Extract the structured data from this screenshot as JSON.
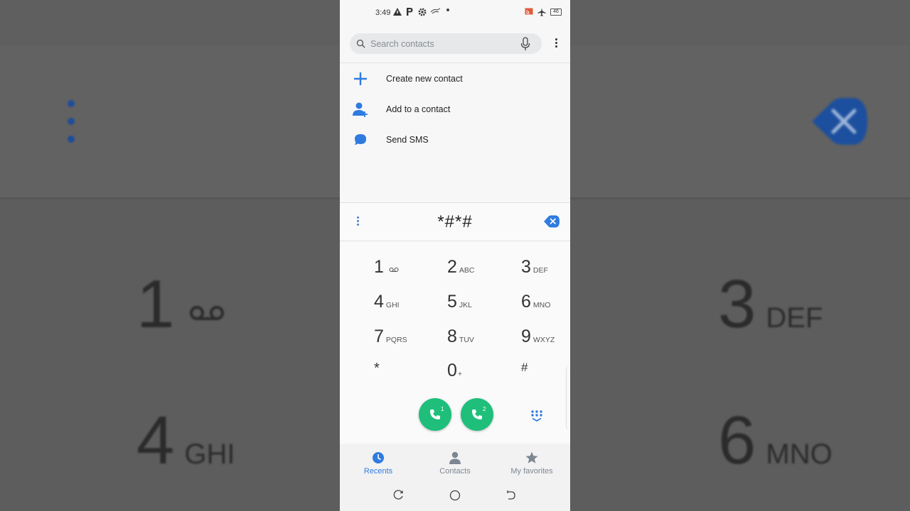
{
  "status_bar": {
    "time": "3:49",
    "battery": "46"
  },
  "search": {
    "placeholder": "Search contacts"
  },
  "menu": {
    "items": [
      {
        "label": "Create new contact",
        "icon": "plus-icon"
      },
      {
        "label": "Add to a contact",
        "icon": "add-person-icon"
      },
      {
        "label": "Send SMS",
        "icon": "message-icon"
      }
    ]
  },
  "dialer": {
    "entered_number": "*#*#",
    "keys": [
      {
        "digit": "1",
        "letters": ""
      },
      {
        "digit": "2",
        "letters": "ABC"
      },
      {
        "digit": "3",
        "letters": "DEF"
      },
      {
        "digit": "4",
        "letters": "GHI"
      },
      {
        "digit": "5",
        "letters": "JKL"
      },
      {
        "digit": "6",
        "letters": "MNO"
      },
      {
        "digit": "7",
        "letters": "PQRS"
      },
      {
        "digit": "8",
        "letters": "TUV"
      },
      {
        "digit": "9",
        "letters": "WXYZ"
      },
      {
        "digit": "*",
        "letters": ""
      },
      {
        "digit": "0",
        "letters": "+"
      },
      {
        "digit": "#",
        "letters": ""
      }
    ],
    "call_buttons": [
      {
        "sim": "1"
      },
      {
        "sim": "2"
      }
    ]
  },
  "tabs": [
    {
      "label": "Recents",
      "active": true
    },
    {
      "label": "Contacts",
      "active": false
    },
    {
      "label": "My favorites",
      "active": false
    }
  ],
  "background": {
    "digits": [
      {
        "digit": "1",
        "letters": ""
      },
      {
        "digit": "3",
        "letters": "DEF"
      },
      {
        "digit": "4",
        "letters": "GHI"
      },
      {
        "digit": "6",
        "letters": "MNO"
      }
    ]
  },
  "colors": {
    "accent": "#2f7be0",
    "call_green": "#1fbf7b",
    "tab_active": "#2f7be0",
    "tab_inactive": "#7d8793"
  }
}
